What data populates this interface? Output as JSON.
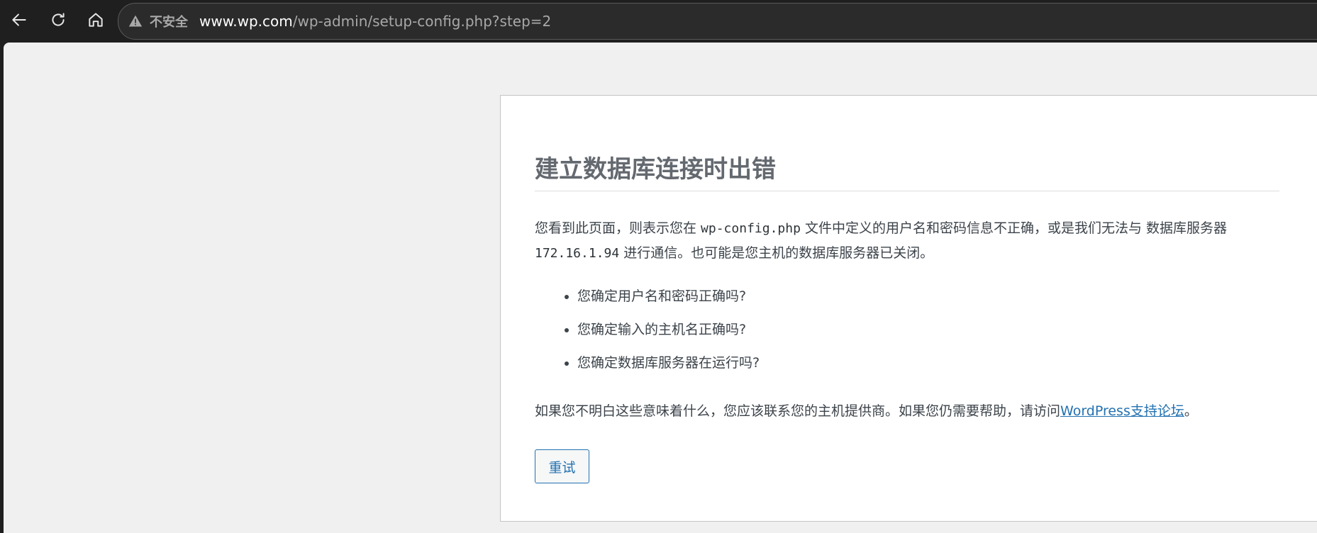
{
  "browser": {
    "security_label": "不安全",
    "url_host": "www.wp.com",
    "url_path": "/wp-admin/setup-config.php?step=2"
  },
  "page": {
    "title": "建立数据库连接时出错",
    "intro": {
      "part1": "您看到此页面，则表示您在 ",
      "config_file": "wp-config.php",
      "part2": " 文件中定义的用户名和密码信息不正确，或是我们无法与 数据库服务器 ",
      "db_host": "172.16.1.94",
      "part3": " 进行通信。也可能是您主机的数据库服务器已关闭。"
    },
    "checklist": [
      "您确定用户名和密码正确吗?",
      "您确定输入的主机名正确吗?",
      "您确定数据库服务器在运行吗?"
    ],
    "help": {
      "text": "如果您不明白这些意味着什么，您应该联系您的主机提供商。如果您仍需要帮助，请访问",
      "link": "WordPress支持论坛",
      "end": "。"
    },
    "retry_label": "重试"
  }
}
